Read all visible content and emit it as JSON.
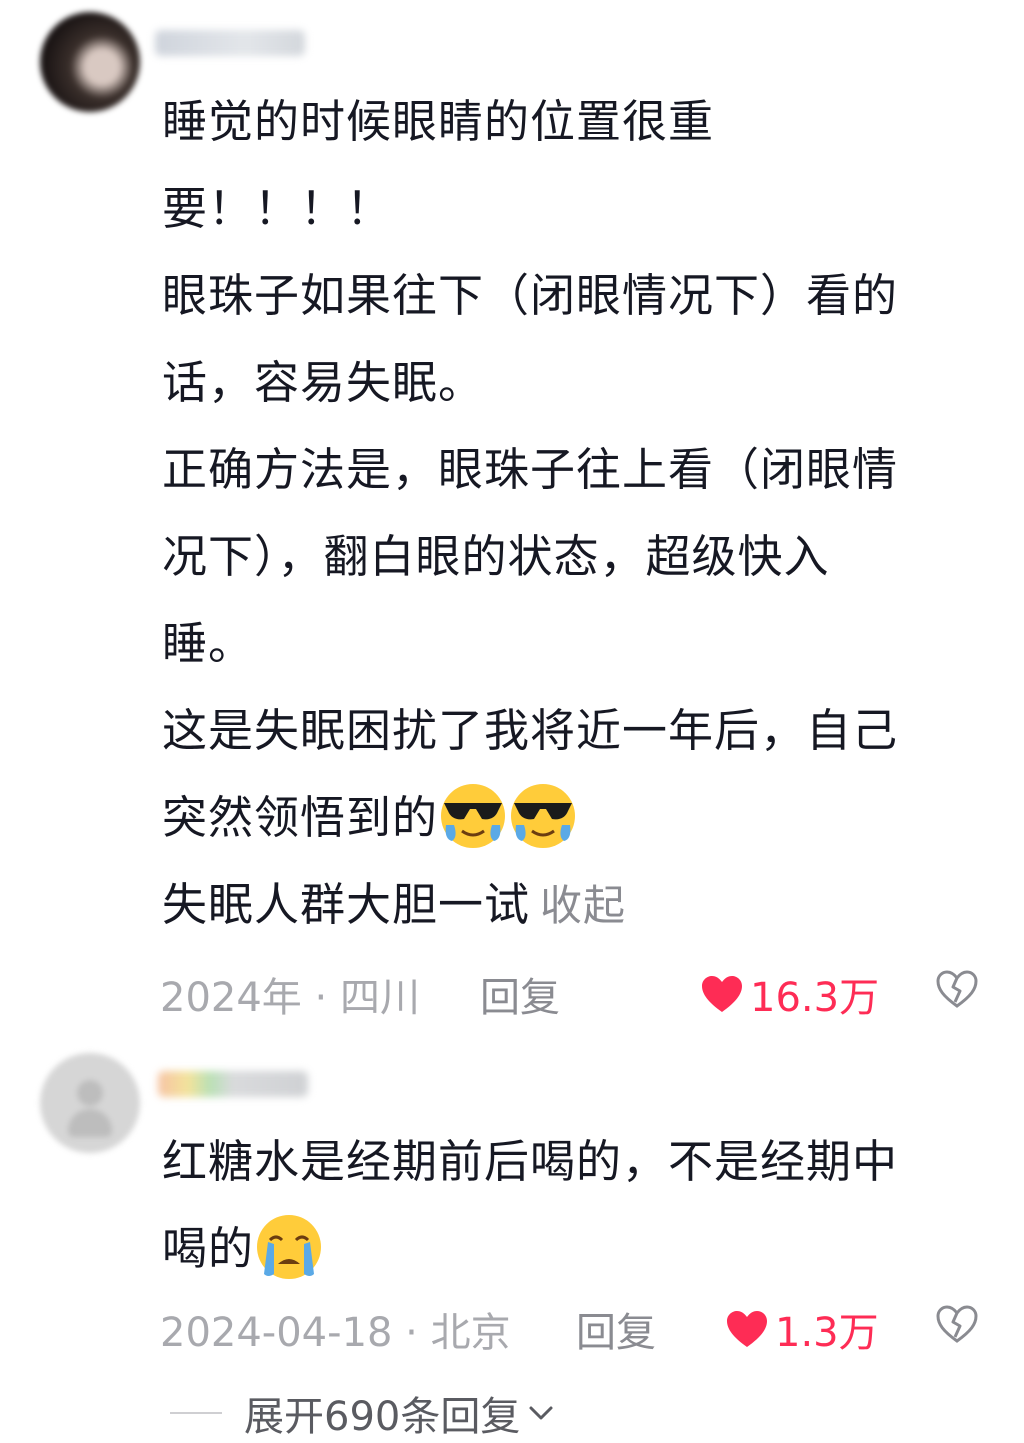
{
  "comments": [
    {
      "lines": [
        "睡觉的时候眼睛的位置很重",
        "要！！！！",
        "眼珠子如果往下（闭眼情况下）看的",
        "话，容易失眠。",
        "正确方法是，眼珠子往上看（闭眼情",
        "况下），翻白眼的状态，超级快入",
        "睡。",
        "这是失眠困扰了我将近一年后，自己",
        "突然领悟到的",
        "失眠人群大胆一试"
      ],
      "collapse_label": "收起",
      "date": "2024年 · 四川",
      "reply_label": "回复",
      "like_count": "16.3万",
      "emojis": [
        "cool-sunglasses-tear-emoji",
        "cool-sunglasses-tear-emoji"
      ]
    },
    {
      "lines": [
        "红糖水是经期前后喝的，不是经期中",
        "喝的"
      ],
      "date": "2024-04-18 · 北京",
      "reply_label": "回复",
      "like_count": "1.3万",
      "emojis": [
        "loudly-crying-emoji"
      ]
    }
  ],
  "expand_replies_label": "展开690条回复",
  "colors": {
    "like": "#fe2c55",
    "meta": "#a8a9ae",
    "text": "#161823"
  }
}
